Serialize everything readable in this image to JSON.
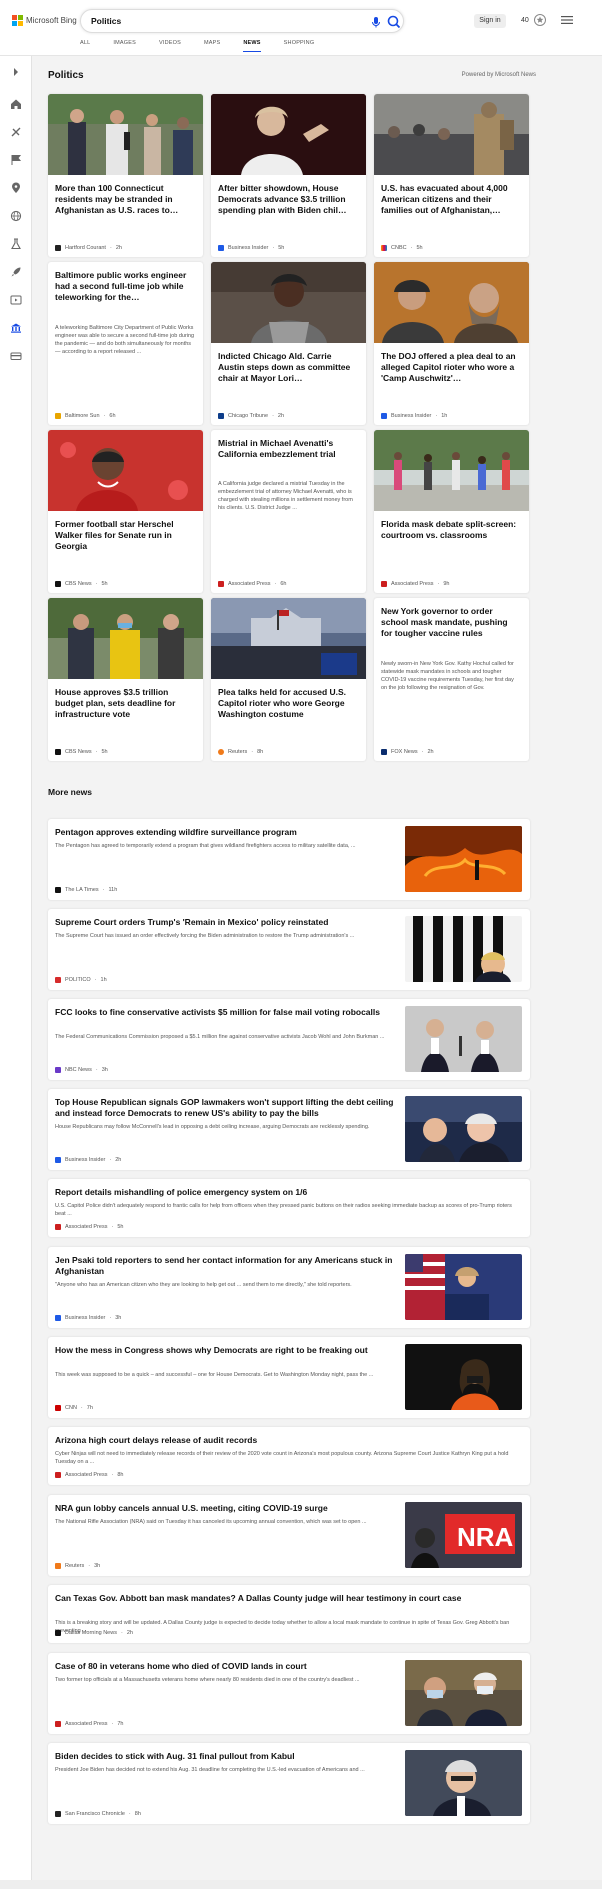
{
  "header": {
    "brand": "Microsoft Bing",
    "search_value": "Politics",
    "signin_label": "Sign in",
    "rewards_count": "40",
    "nav_tabs": [
      "ALL",
      "IMAGES",
      "VIDEOS",
      "MAPS",
      "NEWS",
      "SHOPPING"
    ],
    "active_tab": "NEWS"
  },
  "section": {
    "title": "Politics",
    "powered_by": "Powered by Microsoft News"
  },
  "cards": [
    {
      "title": "More than 100 Connecticut residents may be stranded in Afghanistan as U.S. races to…",
      "source": "Hartford Courant",
      "time": "2h",
      "snippet": ""
    },
    {
      "title": "After bitter showdown, House Democrats advance $3.5 trillion spending plan with Biden chil…",
      "source": "Business Insider",
      "time": "5h",
      "snippet": ""
    },
    {
      "title": "U.S. has evacuated about 4,000 American citizens and their families out of Afghanistan,…",
      "source": "CNBC",
      "time": "5h",
      "snippet": ""
    },
    {
      "title": "Baltimore public works engineer had a second full-time job while teleworking for the…",
      "source": "Baltimore Sun",
      "time": "6h",
      "snippet": "A teleworking Baltimore City Department of Public Works engineer was able to secure a second full-time job during the pandemic — and do both simultaneously for months — according to a report released ..."
    },
    {
      "title": "Indicted Chicago Ald. Carrie Austin steps down as committee chair at Mayor Lori…",
      "source": "Chicago Tribune",
      "time": "2h",
      "snippet": ""
    },
    {
      "title": "The DOJ offered a plea deal to an alleged Capitol rioter who wore a 'Camp Auschwitz'…",
      "source": "Business Insider",
      "time": "1h",
      "snippet": ""
    },
    {
      "title": "Former football star Herschel Walker files for Senate run in Georgia",
      "source": "CBS News",
      "time": "5h",
      "snippet": ""
    },
    {
      "title": "Mistrial in Michael Avenatti's California embezzlement trial",
      "source": "Associated Press",
      "time": "6h",
      "snippet": "A California judge declared a mistrial Tuesday in the embezzlement trial of attorney Michael Avenatti, who is charged with stealing millions in settlement money from his clients. U.S. District Judge ..."
    },
    {
      "title": "Florida mask debate split-screen: courtroom vs. classrooms",
      "source": "Associated Press",
      "time": "9h",
      "snippet": ""
    },
    {
      "title": "House approves $3.5 trillion budget plan, sets deadline for infrastructure vote",
      "source": "CBS News",
      "time": "5h",
      "snippet": ""
    },
    {
      "title": "Plea talks held for accused U.S. Capitol rioter who wore George Washington costume",
      "source": "Reuters",
      "time": "8h",
      "snippet": ""
    },
    {
      "title": "New York governor to order school mask mandate, pushing for tougher vaccine rules",
      "source": "FOX News",
      "time": "2h",
      "snippet": "Newly sworn-in New York Gov. Kathy Hochul called for statewide mask mandates in schools and tougher COVID-19 vaccine requirements Tuesday, her first day on the job following the resignation of Gov."
    }
  ],
  "more_news": {
    "title": "More news",
    "items": [
      {
        "title": "Pentagon approves extending wildfire surveillance program",
        "snippet": "The Pentagon has agreed to temporarily extend a program that gives wildland firefighters access to military satellite data, ...",
        "source": "The LA Times",
        "time": "11h",
        "has_image": true
      },
      {
        "title": "Supreme Court orders Trump's 'Remain in Mexico' policy reinstated",
        "snippet": "The Supreme Court has issued an order effectively forcing the Biden administration to restore the Trump administration's ...",
        "source": "POLITICO",
        "time": "1h",
        "has_image": true
      },
      {
        "title": "FCC looks to fine conservative activists $5 million for false mail voting robocalls",
        "snippet": "The Federal Communications Commission proposed a $5.1 million fine against conservative activists Jacob Wohl and John Burkman ...",
        "source": "NBC News",
        "time": "3h",
        "has_image": true
      },
      {
        "title": "Top House Republican signals GOP lawmakers won't support lifting the debt ceiling and instead force Democrats to renew US's ability to pay the bills",
        "snippet": "House Republicans may follow McConnell's lead in opposing a debt ceiling increase, arguing Democrats are recklessly spending.",
        "source": "Business Insider",
        "time": "2h",
        "has_image": true
      },
      {
        "title": "Report details mishandling of police emergency system on 1/6",
        "snippet": "U.S. Capitol Police didn't adequately respond to frantic calls for help from officers when they pressed panic buttons on their radios seeking immediate backup as scores of pro-Trump rioters beat ...",
        "source": "Associated Press",
        "time": "5h",
        "has_image": false
      },
      {
        "title": "Jen Psaki told reporters to send her contact information for any Americans stuck in Afghanistan",
        "snippet": "\"Anyone who has an American citizen who they are looking to help get out ... send them to me directly,\" she told reporters.",
        "source": "Business Insider",
        "time": "3h",
        "has_image": true
      },
      {
        "title": "How the mess in Congress shows why Democrats are right to be freaking out",
        "snippet": "This week was supposed to be a quick – and successful – one for House Democrats. Get to Washington Monday night, pass the ...",
        "source": "CNN",
        "time": "7h",
        "has_image": true
      },
      {
        "title": "Arizona high court delays release of audit records",
        "snippet": "Cyber Ninjas will not need to immediately release records of their review of the 2020 vote count in Arizona's most populous county. Arizona Supreme Court Justice Kathryn King put a hold Tuesday on a ...",
        "source": "Associated Press",
        "time": "8h",
        "has_image": false
      },
      {
        "title": "NRA gun lobby cancels annual U.S. meeting, citing COVID-19 surge",
        "snippet": "The National Rifle Association (NRA) said on Tuesday it has canceled its upcoming annual convention, which was set to open ...",
        "source": "Reuters",
        "time": "3h",
        "has_image": true
      },
      {
        "title": "Can Texas Gov. Abbott ban mask mandates? A Dallas County judge will hear testimony in court case",
        "snippet": "This is a breaking story and will be updated. A Dallas County judge is expected to decide today whether to allow a local mask mandate to continue in spite of Texas Gov. Greg Abbott's ban preventing ...",
        "source": "Dallas Morning News",
        "time": "2h",
        "has_image": false
      },
      {
        "title": "Case of 80 in veterans home who died of COVID lands in court",
        "snippet": "Two former top officials at a Massachusetts veterans home where nearly 80 residents died in one of the country's deadliest ...",
        "source": "Associated Press",
        "time": "7h",
        "has_image": true
      },
      {
        "title": "Biden decides to stick with Aug. 31 final pullout from Kabul",
        "snippet": "President Joe Biden has decided not to extend his Aug. 31 deadline for completing the U.S.-led evacuation of Americans and ...",
        "source": "San Francisco Chronicle",
        "time": "8h",
        "has_image": true
      }
    ]
  },
  "icons": [
    "expand-icon",
    "home-icon",
    "sports-icon",
    "flag-icon",
    "location-icon",
    "world-icon",
    "science-icon",
    "rocket-icon",
    "entertainment-icon",
    "politics-icon",
    "money-icon"
  ],
  "colors": {
    "accent": "#174ae4",
    "brand_red": "#f25022",
    "brand_green": "#7fba00",
    "brand_blue": "#00a4ef",
    "brand_yellow": "#ffb900"
  }
}
